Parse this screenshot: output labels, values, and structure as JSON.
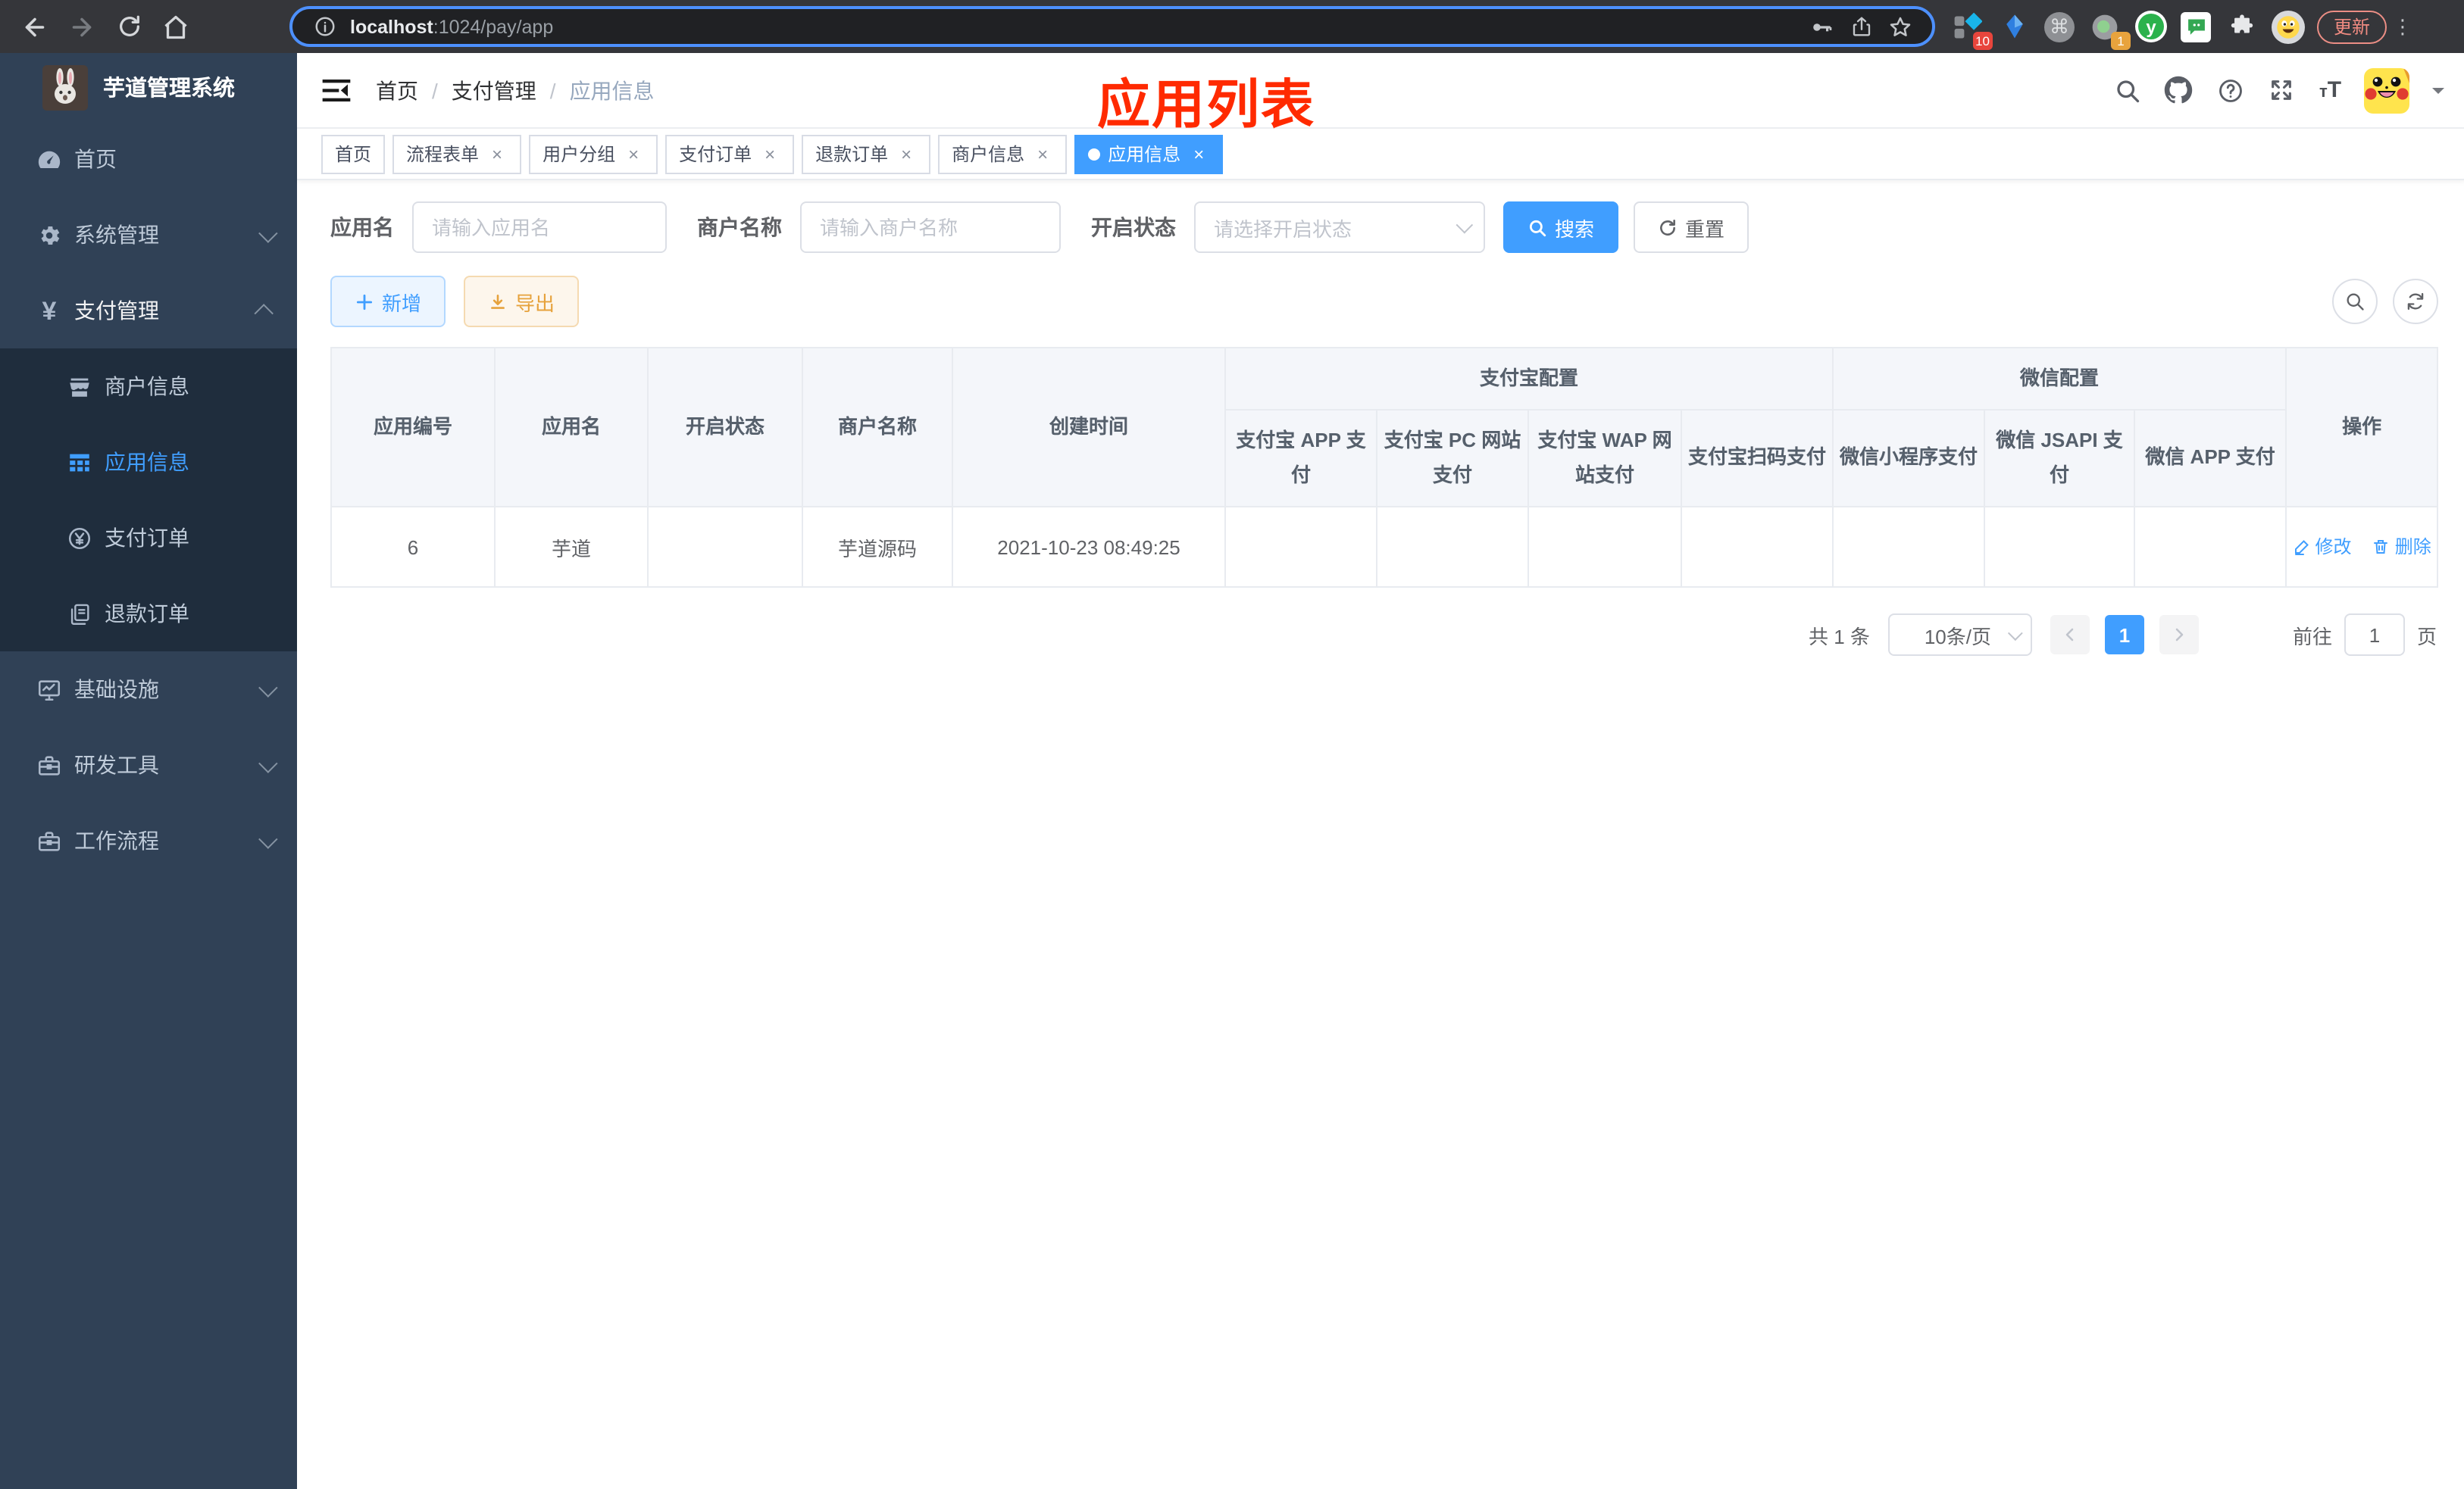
{
  "colors": {
    "accent": "#409eff",
    "success": "#1fbc62",
    "danger": "#f5494d",
    "warning": "#e6a23c",
    "annotation_red": "#ff2a00"
  },
  "browser": {
    "url_host": "localhost",
    "url_path": ":1024/pay/app",
    "update_label": "更新",
    "ext_badge_10": "10",
    "ext_badge_1": "1",
    "command_char": "⌘",
    "youdao_letter": "y",
    "kebab_char": "⋮"
  },
  "sidebar": {
    "logo_title": "芋道管理系统",
    "yen_char": "¥",
    "items": {
      "home": "首页",
      "system": "系统管理",
      "payment": "支付管理",
      "merchant": "商户信息",
      "app": "应用信息",
      "pay_order": "支付订单",
      "refund_order": "退款订单",
      "infra": "基础设施",
      "dev_tools": "研发工具",
      "workflow": "工作流程"
    }
  },
  "header": {
    "breadcrumb": {
      "home": "首页",
      "payment": "支付管理",
      "app": "应用信息",
      "separator": "/"
    },
    "annotation_title": "应用列表",
    "font_icon_small": "т",
    "font_icon_big": "T"
  },
  "tabs": {
    "t0": "首页",
    "t1": "流程表单",
    "t2": "用户分组",
    "t3": "支付订单",
    "t4": "退款订单",
    "t5": "商户信息",
    "t6": "应用信息",
    "close_char": "×"
  },
  "filters": {
    "app_name_label": "应用名",
    "app_name_placeholder": "请输入应用名",
    "merchant_label": "商户名称",
    "merchant_placeholder": "请输入商户名称",
    "status_label": "开启状态",
    "status_placeholder": "请选择开启状态",
    "search_label": "搜索",
    "reset_label": "重置"
  },
  "toolbar": {
    "add_label": "新增",
    "export_label": "导出"
  },
  "table": {
    "col_id": "应用编号",
    "col_name": "应用名",
    "col_status": "开启状态",
    "col_merchant": "商户名称",
    "col_created": "创建时间",
    "group_alipay": "支付宝配置",
    "group_wechat": "微信配置",
    "sub": {
      "s0": "支付宝 APP 支付",
      "s1": "支付宝 PC 网站支付",
      "s2": "支付宝 WAP 网站支付",
      "s3": "支付宝扫码支付",
      "s4": "微信小程序支付",
      "s5": "微信 JSAPI 支付",
      "s6": "微信 APP 支付"
    },
    "col_ops": "操作",
    "row": {
      "id": "6",
      "name": "芋道",
      "merchant": "芋道源码",
      "created": "2021-10-23 08:49:25",
      "statuses": {
        "s0": "no",
        "s1": "no",
        "s2": "no",
        "s3": "no",
        "s4": "no",
        "s5": "yes",
        "s6": "no"
      },
      "edit_label": "修改",
      "delete_label": "删除"
    }
  },
  "pagination": {
    "total": "共 1 条",
    "page_size": "10条/页",
    "page": "1",
    "goto_label": "前往",
    "goto_value": "1",
    "unit_label": "页"
  }
}
